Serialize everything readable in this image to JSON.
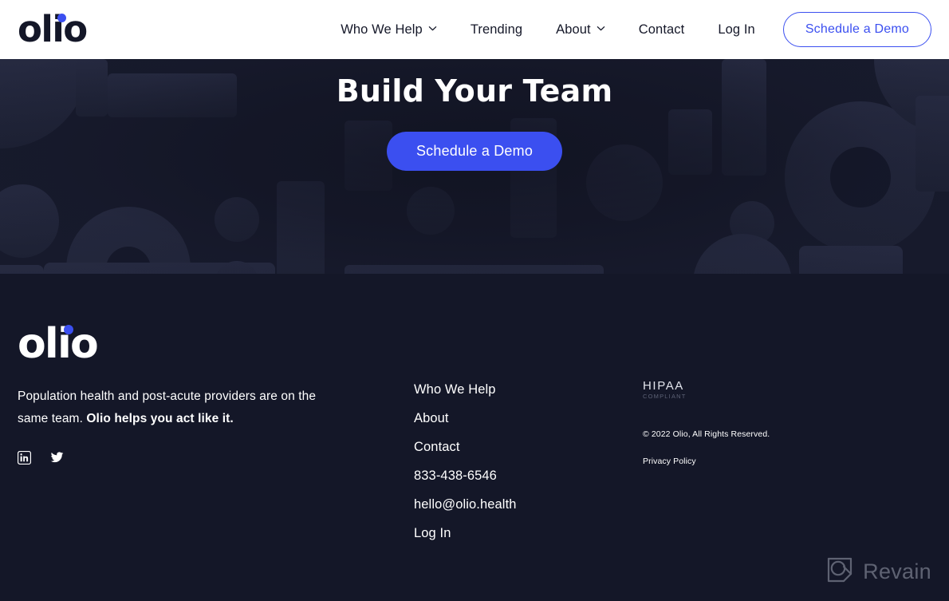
{
  "brand": {
    "name": "olio",
    "accent_color": "#3b4ff0",
    "dark_navy": "#141728",
    "hero_navy": "#171a2c"
  },
  "header": {
    "logo_text": "olio",
    "nav_items": [
      {
        "label": "Who We Help",
        "has_dropdown": true,
        "icon": "chevron-down-icon"
      },
      {
        "label": "Trending",
        "has_dropdown": false
      },
      {
        "label": "About",
        "has_dropdown": true,
        "icon": "chevron-down-icon"
      },
      {
        "label": "Contact",
        "has_dropdown": false
      },
      {
        "label": "Log In",
        "has_dropdown": false
      }
    ],
    "cta_label": "Schedule a Demo"
  },
  "hero": {
    "title": "Build Your Team",
    "cta_label": "Schedule a Demo",
    "background_style": "geometric-shapes-pattern"
  },
  "footer": {
    "logo_text": "olio",
    "tagline_plain": "Population health and post-acute providers are on the same team. ",
    "tagline_bold": "Olio helps you act like it.",
    "socials": [
      {
        "name": "linkedin-icon",
        "label": "LinkedIn"
      },
      {
        "name": "twitter-icon",
        "label": "Twitter"
      }
    ],
    "links": [
      "Who We Help",
      "About",
      "Contact",
      "833-438-6546",
      "hello@olio.health",
      "Log In"
    ],
    "badge": {
      "line1": "HIPAA",
      "line2": "COMPLIANT"
    },
    "copyright": "© 2022 Olio, All Rights Reserved.",
    "privacy_label": "Privacy Policy"
  },
  "watermark": {
    "label": "Revain",
    "icon": "revain-logo-icon"
  }
}
